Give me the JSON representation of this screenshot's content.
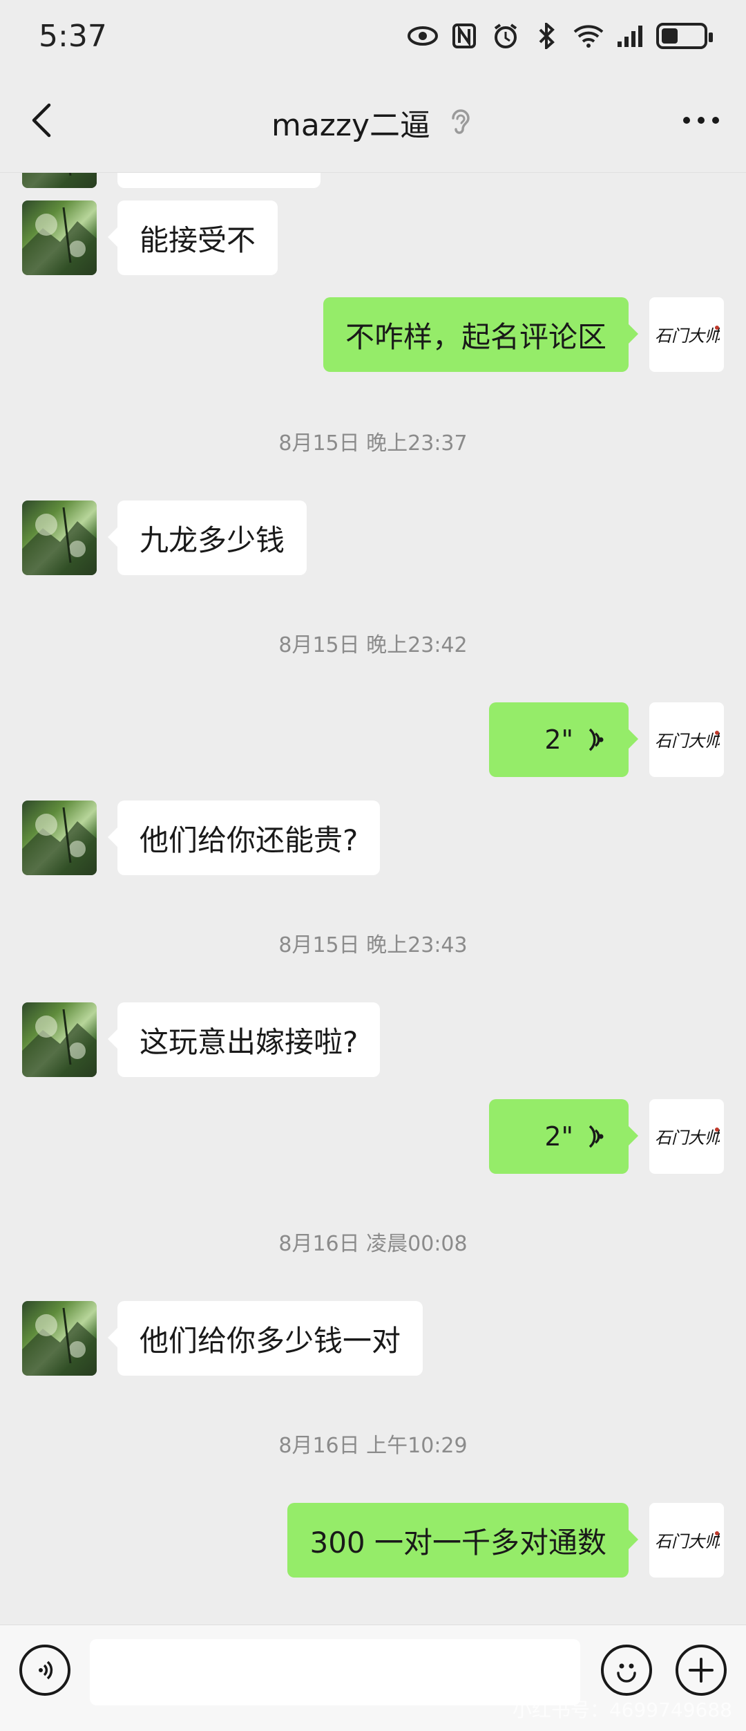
{
  "status": {
    "time": "5:37"
  },
  "header": {
    "title": "mazzy二逼"
  },
  "contact": {
    "avatar_label": "石门大帅"
  },
  "messages": [
    {
      "type": "text",
      "dir": "in",
      "text": "能接受不"
    },
    {
      "type": "text",
      "dir": "out",
      "text": "不咋样，起名评论区"
    },
    {
      "type": "timestamp",
      "text": "8月15日 晚上23:37"
    },
    {
      "type": "text",
      "dir": "in",
      "text": "九龙多少钱"
    },
    {
      "type": "timestamp",
      "text": "8月15日 晚上23:42"
    },
    {
      "type": "voice",
      "dir": "out",
      "text": "2\""
    },
    {
      "type": "text",
      "dir": "in",
      "text": "他们给你还能贵?"
    },
    {
      "type": "timestamp",
      "text": "8月15日 晚上23:43"
    },
    {
      "type": "text",
      "dir": "in",
      "text": "这玩意出嫁接啦?"
    },
    {
      "type": "voice",
      "dir": "out",
      "text": "2\""
    },
    {
      "type": "timestamp",
      "text": "8月16日 凌晨00:08"
    },
    {
      "type": "text",
      "dir": "in",
      "text": "他们给你多少钱一对"
    },
    {
      "type": "timestamp",
      "text": "8月16日 上午10:29"
    },
    {
      "type": "text",
      "dir": "out",
      "text": "300 一对一千多对通数"
    }
  ],
  "input": {
    "value": "",
    "placeholder": ""
  },
  "watermark": "小红书号：4699749688",
  "colors": {
    "incoming_bubble": "#ffffff",
    "outgoing_bubble": "#95ec69",
    "background": "#ededed",
    "timestamp": "#8b8b8b"
  },
  "icons": [
    "back-arrow-icon",
    "ear-icon",
    "more-icon",
    "voice-input-icon",
    "emoji-icon",
    "plus-icon",
    "voice-wave-icon"
  ]
}
